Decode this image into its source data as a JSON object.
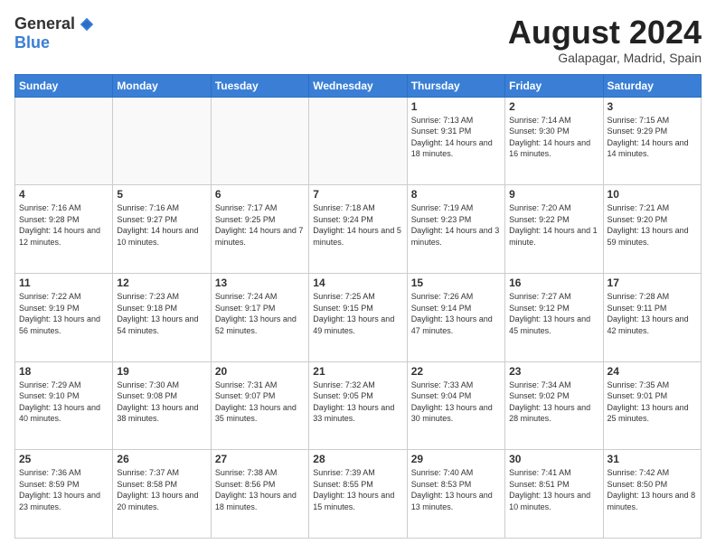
{
  "header": {
    "logo_general": "General",
    "logo_blue": "Blue",
    "month_year": "August 2024",
    "location": "Galapagar, Madrid, Spain"
  },
  "days_of_week": [
    "Sunday",
    "Monday",
    "Tuesday",
    "Wednesday",
    "Thursday",
    "Friday",
    "Saturday"
  ],
  "weeks": [
    [
      {
        "day": "",
        "empty": true
      },
      {
        "day": "",
        "empty": true
      },
      {
        "day": "",
        "empty": true
      },
      {
        "day": "",
        "empty": true
      },
      {
        "day": "1",
        "sunrise": "7:13 AM",
        "sunset": "9:31 PM",
        "daylight": "14 hours and 18 minutes."
      },
      {
        "day": "2",
        "sunrise": "7:14 AM",
        "sunset": "9:30 PM",
        "daylight": "14 hours and 16 minutes."
      },
      {
        "day": "3",
        "sunrise": "7:15 AM",
        "sunset": "9:29 PM",
        "daylight": "14 hours and 14 minutes."
      }
    ],
    [
      {
        "day": "4",
        "sunrise": "7:16 AM",
        "sunset": "9:28 PM",
        "daylight": "14 hours and 12 minutes."
      },
      {
        "day": "5",
        "sunrise": "7:16 AM",
        "sunset": "9:27 PM",
        "daylight": "14 hours and 10 minutes."
      },
      {
        "day": "6",
        "sunrise": "7:17 AM",
        "sunset": "9:25 PM",
        "daylight": "14 hours and 7 minutes."
      },
      {
        "day": "7",
        "sunrise": "7:18 AM",
        "sunset": "9:24 PM",
        "daylight": "14 hours and 5 minutes."
      },
      {
        "day": "8",
        "sunrise": "7:19 AM",
        "sunset": "9:23 PM",
        "daylight": "14 hours and 3 minutes."
      },
      {
        "day": "9",
        "sunrise": "7:20 AM",
        "sunset": "9:22 PM",
        "daylight": "14 hours and 1 minute."
      },
      {
        "day": "10",
        "sunrise": "7:21 AM",
        "sunset": "9:20 PM",
        "daylight": "13 hours and 59 minutes."
      }
    ],
    [
      {
        "day": "11",
        "sunrise": "7:22 AM",
        "sunset": "9:19 PM",
        "daylight": "13 hours and 56 minutes."
      },
      {
        "day": "12",
        "sunrise": "7:23 AM",
        "sunset": "9:18 PM",
        "daylight": "13 hours and 54 minutes."
      },
      {
        "day": "13",
        "sunrise": "7:24 AM",
        "sunset": "9:17 PM",
        "daylight": "13 hours and 52 minutes."
      },
      {
        "day": "14",
        "sunrise": "7:25 AM",
        "sunset": "9:15 PM",
        "daylight": "13 hours and 49 minutes."
      },
      {
        "day": "15",
        "sunrise": "7:26 AM",
        "sunset": "9:14 PM",
        "daylight": "13 hours and 47 minutes."
      },
      {
        "day": "16",
        "sunrise": "7:27 AM",
        "sunset": "9:12 PM",
        "daylight": "13 hours and 45 minutes."
      },
      {
        "day": "17",
        "sunrise": "7:28 AM",
        "sunset": "9:11 PM",
        "daylight": "13 hours and 42 minutes."
      }
    ],
    [
      {
        "day": "18",
        "sunrise": "7:29 AM",
        "sunset": "9:10 PM",
        "daylight": "13 hours and 40 minutes."
      },
      {
        "day": "19",
        "sunrise": "7:30 AM",
        "sunset": "9:08 PM",
        "daylight": "13 hours and 38 minutes."
      },
      {
        "day": "20",
        "sunrise": "7:31 AM",
        "sunset": "9:07 PM",
        "daylight": "13 hours and 35 minutes."
      },
      {
        "day": "21",
        "sunrise": "7:32 AM",
        "sunset": "9:05 PM",
        "daylight": "13 hours and 33 minutes."
      },
      {
        "day": "22",
        "sunrise": "7:33 AM",
        "sunset": "9:04 PM",
        "daylight": "13 hours and 30 minutes."
      },
      {
        "day": "23",
        "sunrise": "7:34 AM",
        "sunset": "9:02 PM",
        "daylight": "13 hours and 28 minutes."
      },
      {
        "day": "24",
        "sunrise": "7:35 AM",
        "sunset": "9:01 PM",
        "daylight": "13 hours and 25 minutes."
      }
    ],
    [
      {
        "day": "25",
        "sunrise": "7:36 AM",
        "sunset": "8:59 PM",
        "daylight": "13 hours and 23 minutes."
      },
      {
        "day": "26",
        "sunrise": "7:37 AM",
        "sunset": "8:58 PM",
        "daylight": "13 hours and 20 minutes."
      },
      {
        "day": "27",
        "sunrise": "7:38 AM",
        "sunset": "8:56 PM",
        "daylight": "13 hours and 18 minutes."
      },
      {
        "day": "28",
        "sunrise": "7:39 AM",
        "sunset": "8:55 PM",
        "daylight": "13 hours and 15 minutes."
      },
      {
        "day": "29",
        "sunrise": "7:40 AM",
        "sunset": "8:53 PM",
        "daylight": "13 hours and 13 minutes."
      },
      {
        "day": "30",
        "sunrise": "7:41 AM",
        "sunset": "8:51 PM",
        "daylight": "13 hours and 10 minutes."
      },
      {
        "day": "31",
        "sunrise": "7:42 AM",
        "sunset": "8:50 PM",
        "daylight": "13 hours and 8 minutes."
      }
    ]
  ],
  "labels": {
    "sunrise": "Sunrise:",
    "sunset": "Sunset:",
    "daylight": "Daylight:"
  }
}
